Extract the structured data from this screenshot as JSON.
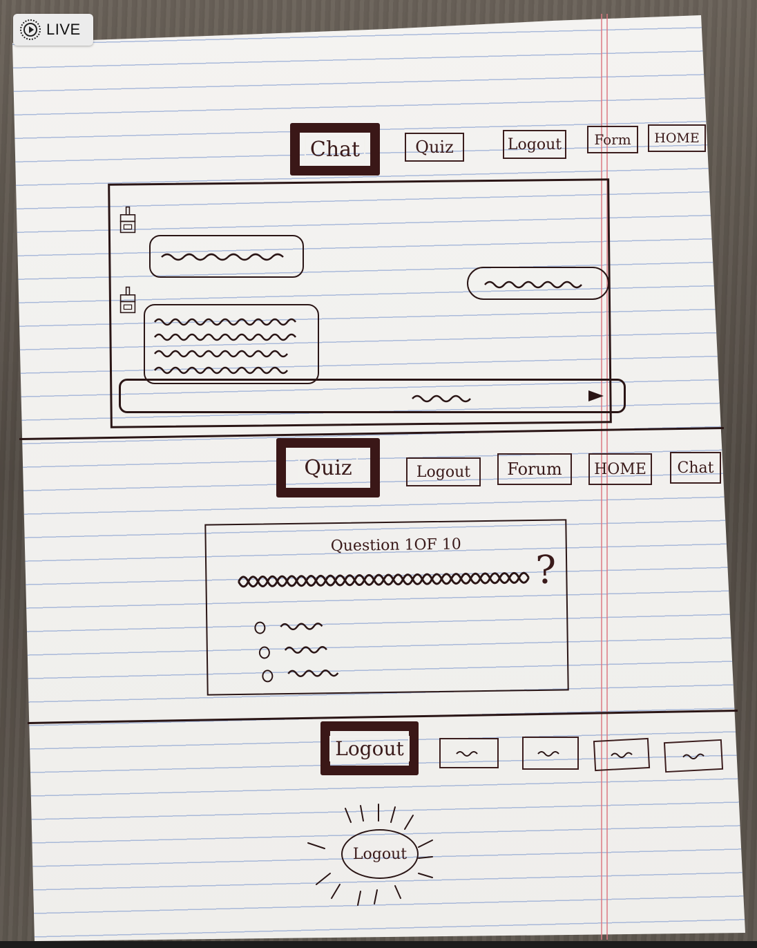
{
  "badge": {
    "label": "LIVE",
    "icon": "live-photo-icon"
  },
  "sketch1": {
    "nav": [
      "Chat",
      "Quiz",
      "Logout",
      "Form",
      "HOME"
    ],
    "active": "Chat"
  },
  "sketch2": {
    "nav": [
      "Quiz",
      "Logout",
      "Forum",
      "HOME",
      "Chat"
    ],
    "active": "Quiz",
    "question_header": "Question 1OF 10",
    "question_mark": "?"
  },
  "sketch3": {
    "active": "Logout",
    "highlight": "Logout"
  },
  "colors": {
    "ink": "#2a1515",
    "paper": "#f2f1ee",
    "table": "#5b544c"
  }
}
